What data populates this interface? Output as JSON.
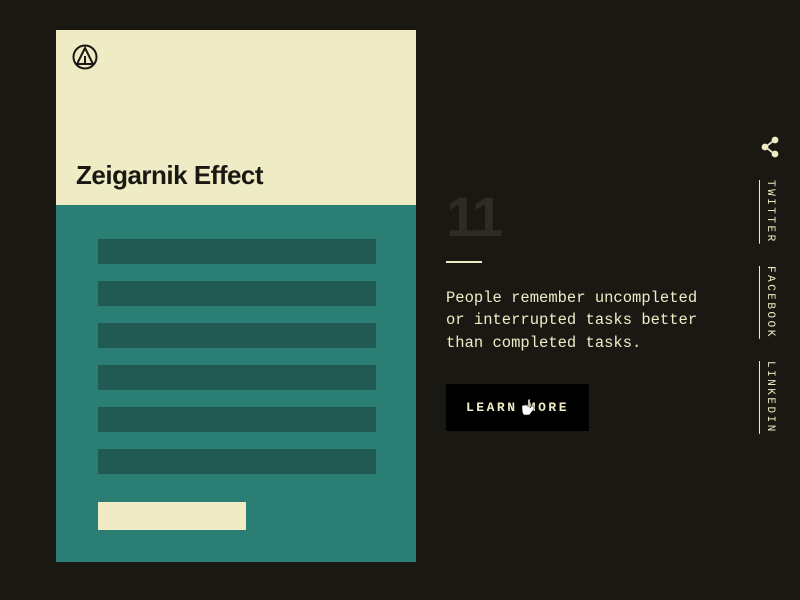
{
  "card": {
    "title": "Zeigarnik Effect"
  },
  "detail": {
    "number": "11",
    "description": "People remember uncompleted or interrupted tasks better than completed tasks.",
    "cta_label": "LEARN MORE"
  },
  "share": {
    "links": [
      {
        "label": "TWITTER"
      },
      {
        "label": "FACEBOOK"
      },
      {
        "label": "LINKEDIN"
      }
    ]
  }
}
